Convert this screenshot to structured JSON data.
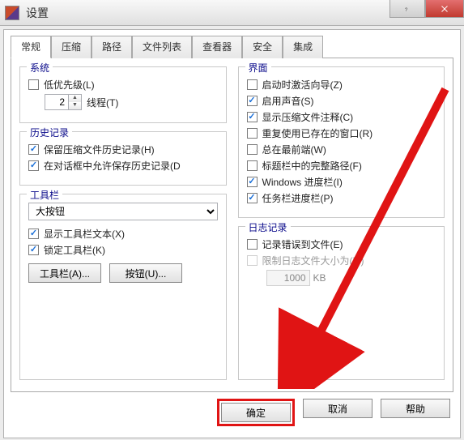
{
  "window": {
    "title": "设置"
  },
  "tabs": [
    "常规",
    "压缩",
    "路径",
    "文件列表",
    "查看器",
    "安全",
    "集成"
  ],
  "activeTab": 0,
  "left": {
    "system": {
      "legend": "系统",
      "low_priority": "低优先级(L)",
      "threads_label": "线程(T)",
      "threads_value": "2"
    },
    "history": {
      "legend": "历史记录",
      "keep_archive_history": "保留压缩文件历史记录(H)",
      "allow_save_in_dialog": "在对话框中允许保存历史记录(D"
    },
    "toolbar": {
      "legend": "工具栏",
      "combo_selected": "大按钮",
      "show_toolbar_text": "显示工具栏文本(X)",
      "lock_toolbar": "锁定工具栏(K)",
      "btn_toolbar": "工具栏(A)...",
      "btn_button": "按钮(U)..."
    }
  },
  "right": {
    "interface": {
      "legend": "界面",
      "activate_wizard": "启动时激活向导(Z)",
      "enable_sound": "启用声音(S)",
      "show_archive_comment": "显示压缩文件注释(C)",
      "reuse_window": "重复使用已存在的窗口(R)",
      "always_on_top": "总在最前端(W)",
      "full_path_title": "标题栏中的完整路径(F)",
      "windows_progress": "Windows 进度栏(I)",
      "taskbar_progress": "任务栏进度栏(P)"
    },
    "log": {
      "legend": "日志记录",
      "log_errors_to_file": "记录错误到文件(E)",
      "limit_log_size": "限制日志文件大小为(M)",
      "log_size_value": "1000",
      "log_size_unit": "KB"
    }
  },
  "buttons": {
    "ok": "确定",
    "cancel": "取消",
    "help": "帮助"
  }
}
